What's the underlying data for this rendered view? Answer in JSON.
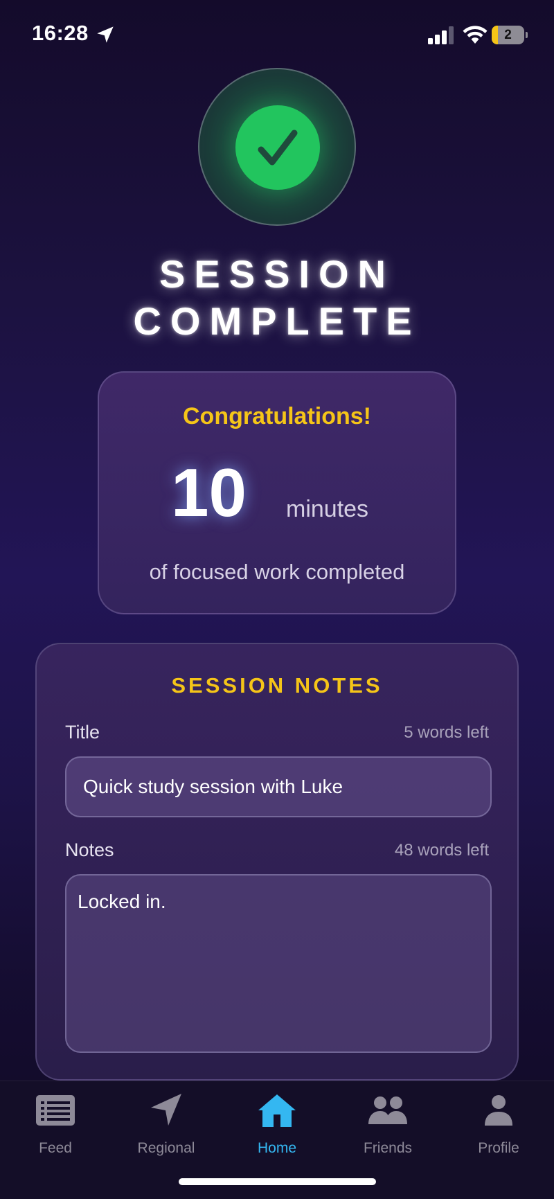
{
  "status_bar": {
    "time": "16:28",
    "battery_level": "2",
    "battery_fraction": 0.2
  },
  "hero": {
    "title_line1": "SESSION",
    "title_line2": "COMPLETE"
  },
  "summary": {
    "congrats": "Congratulations!",
    "minutes_value": "10",
    "minutes_unit": "minutes",
    "caption": "of focused work completed"
  },
  "notes": {
    "heading": "SESSION NOTES",
    "title_label": "Title",
    "title_remaining": "5 words left",
    "title_value": "Quick study session with Luke",
    "notes_label": "Notes",
    "notes_remaining": "48 words left",
    "notes_value": "Locked in."
  },
  "tabs": [
    {
      "label": "Feed",
      "icon": "feed-icon"
    },
    {
      "label": "Regional",
      "icon": "navigation-arrow-icon"
    },
    {
      "label": "Home",
      "icon": "home-icon",
      "active": true
    },
    {
      "label": "Friends",
      "icon": "friends-icon"
    },
    {
      "label": "Profile",
      "icon": "profile-icon"
    }
  ],
  "colors": {
    "accent": "#f5c518",
    "success": "#22c55e",
    "active_tab": "#34b7f1",
    "inactive_tab": "#8e8a98"
  }
}
